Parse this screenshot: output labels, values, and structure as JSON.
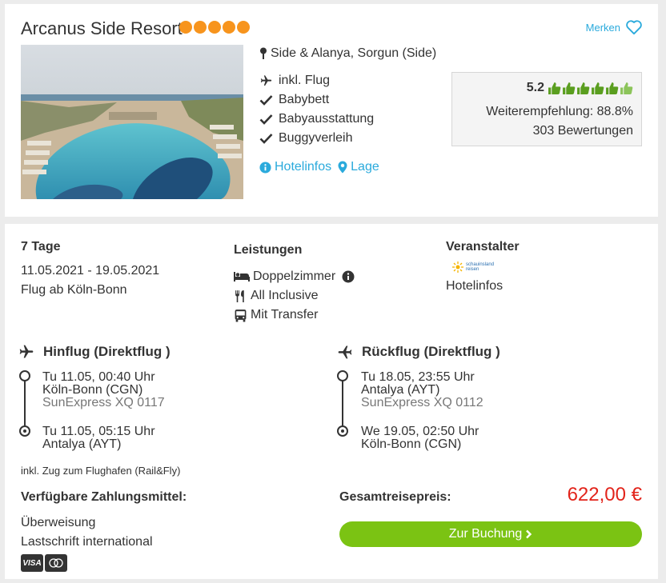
{
  "hotel": {
    "name": "Arcanus Side Resort",
    "stars": 5,
    "location": "Side & Alanya, Sorgun (Side)",
    "merken_label": "Merken",
    "features": [
      {
        "icon": "plane-icon",
        "label": "inkl. Flug"
      },
      {
        "icon": "check-icon",
        "label": "Babybett"
      },
      {
        "icon": "check-icon",
        "label": "Babyausstattung"
      },
      {
        "icon": "check-icon",
        "label": "Buggyverleih"
      }
    ],
    "links": {
      "hotelinfos": "Hotelinfos",
      "lage": "Lage"
    },
    "rating": {
      "score": "5.2",
      "thumbs": 6,
      "recommendation": "Weiterempfehlung: 88.8%",
      "reviews": "303 Bewertungen"
    }
  },
  "trip": {
    "duration": "7 Tage",
    "dates": "11.05.2021 - 19.05.2021",
    "departure": "Flug ab Köln-Bonn",
    "services_title": "Leistungen",
    "services": [
      {
        "icon": "bed-icon",
        "label": "Doppelzimmer"
      },
      {
        "icon": "cutlery-icon",
        "label": "All Inclusive"
      },
      {
        "icon": "bus-icon",
        "label": "Mit Transfer"
      }
    ],
    "operator_title": "Veranstalter",
    "operator_logo_text": "schauinsland reisen",
    "operator_link": "Hotelinfos"
  },
  "flights": {
    "outbound": {
      "title": "Hinflug (Direktflug )",
      "dep_time": "Tu 11.05, 00:40 Uhr",
      "dep_airport": "Köln-Bonn (CGN)",
      "carrier": "SunExpress XQ 0117",
      "arr_time": "Tu 11.05, 05:15 Uhr",
      "arr_airport": "Antalya (AYT)"
    },
    "return": {
      "title": "Rückflug (Direktflug )",
      "dep_time": "Tu 18.05, 23:55 Uhr",
      "dep_airport": "Antalya (AYT)",
      "carrier": "SunExpress XQ 0112",
      "arr_time": "We 19.05, 02:50 Uhr",
      "arr_airport": "Köln-Bonn (CGN)"
    },
    "rail_note": "inkl. Zug zum Flughafen (Rail&Fly)"
  },
  "payment": {
    "title": "Verfügbare Zahlungsmittel:",
    "methods": [
      "Überweisung",
      "Lastschrift international"
    ],
    "badge_visa": "VISA"
  },
  "pricing": {
    "label": "Gesamtreisepreis:",
    "total": "622,00 €",
    "book_button": "Zur Buchung"
  },
  "colors": {
    "accent": "#2aaadc",
    "star": "#f7941d",
    "thumb": "#5a9e1f",
    "price": "#e2231a",
    "button": "#7bc313"
  }
}
